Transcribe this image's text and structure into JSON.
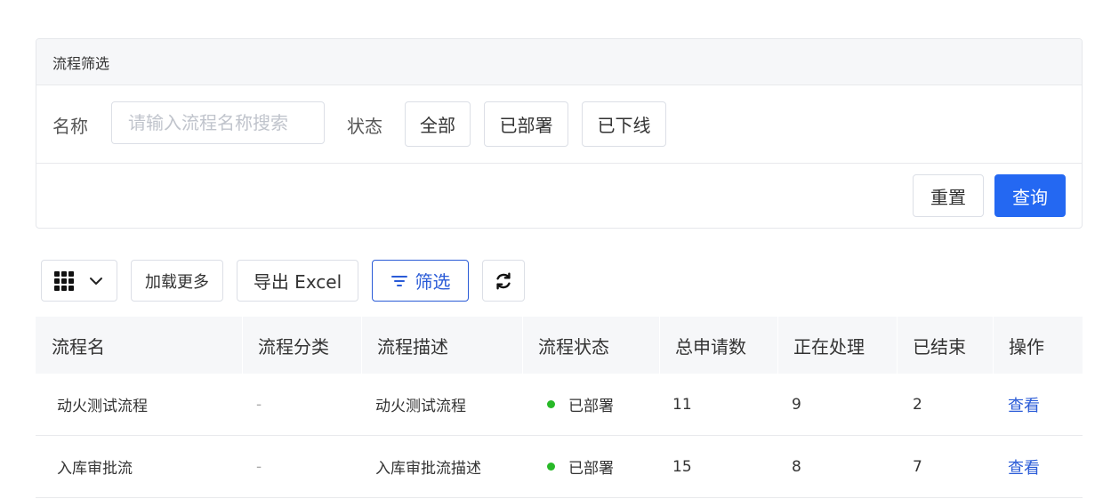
{
  "filter": {
    "title": "流程筛选",
    "name_label": "名称",
    "name_placeholder": "请输入流程名称搜索",
    "status_label": "状态",
    "status_options": [
      "全部",
      "已部署",
      "已下线"
    ],
    "reset_label": "重置",
    "query_label": "查询"
  },
  "toolbar": {
    "columns_icon": "grid-icon",
    "load_more_label": "加载更多",
    "export_label": "导出 Excel",
    "filter_label": "筛选",
    "refresh_icon": "refresh-icon"
  },
  "colors": {
    "primary": "#2468f2",
    "link": "#2a5bd7",
    "deployed": "#28b928"
  },
  "table": {
    "columns": [
      "流程名",
      "流程分类",
      "流程描述",
      "流程状态",
      "总申请数",
      "正在处理",
      "已结束",
      "操作"
    ],
    "rows": [
      {
        "name": "动火测试流程",
        "category": "-",
        "description": "动火测试流程",
        "status": "已部署",
        "total": "11",
        "processing": "9",
        "finished": "2",
        "action": "查看"
      },
      {
        "name": "入库审批流",
        "category": "-",
        "description": "入库审批流描述",
        "status": "已部署",
        "total": "15",
        "processing": "8",
        "finished": "7",
        "action": "查看"
      }
    ]
  }
}
